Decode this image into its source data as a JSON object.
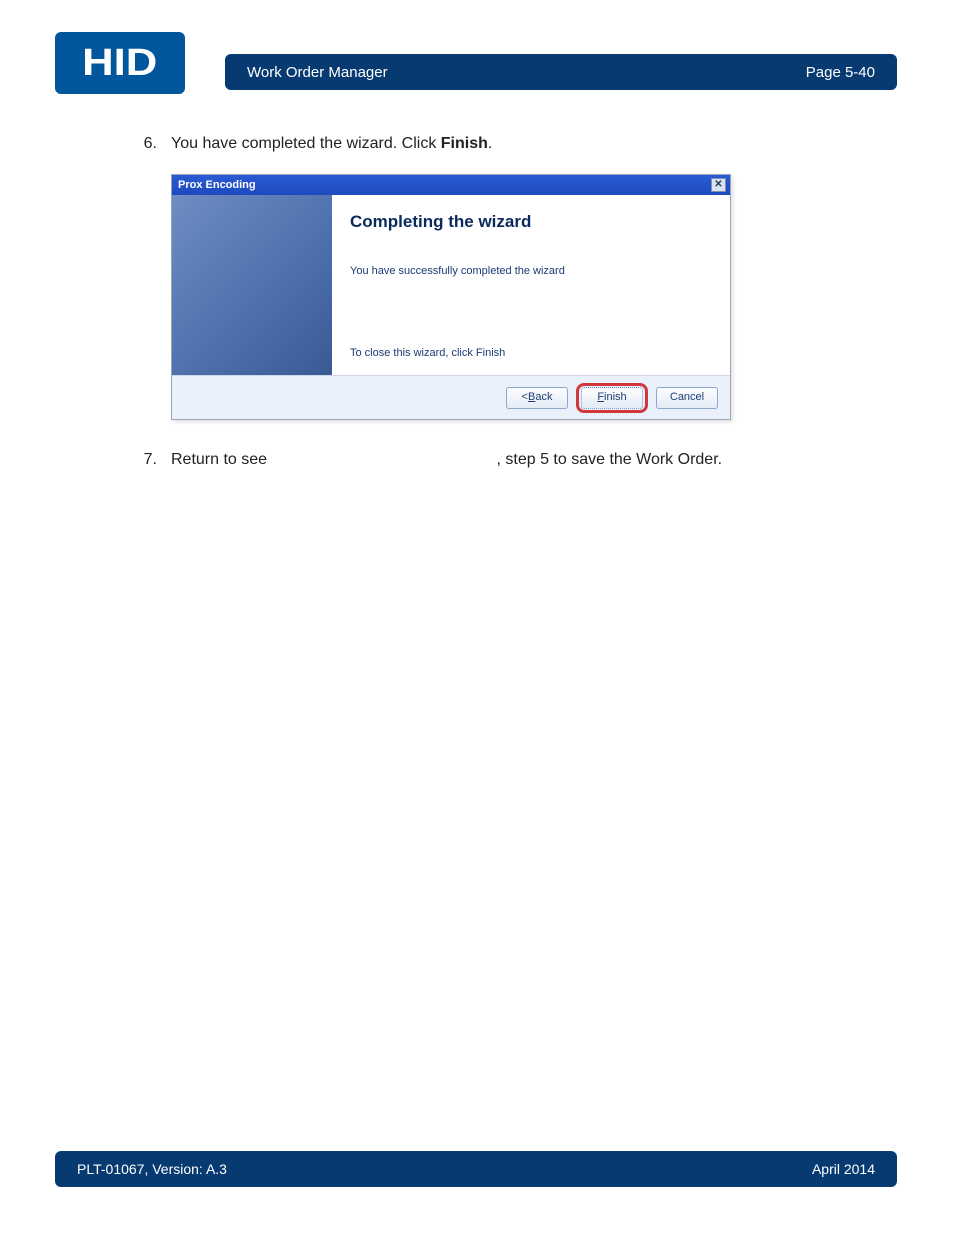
{
  "logo_text": "HID",
  "header": {
    "title": "Work Order Manager",
    "page": "Page 5-40"
  },
  "steps": {
    "s6_num": "6.",
    "s6_pre": "You have completed the wizard. Click ",
    "s6_bold": "Finish",
    "s6_post": ".",
    "s7_num": "7.",
    "s7_pre": "Return to see ",
    "s7_post": ", step 5 to save the Work Order."
  },
  "wizard": {
    "title": "Prox Encoding",
    "heading": "Completing the wizard",
    "message": "You have successfully completed the wizard",
    "close_hint": "To close this wizard, click Finish",
    "back_prefix": "< ",
    "back_u": "B",
    "back_rest": "ack",
    "finish_u": "F",
    "finish_rest": "inish",
    "cancel": "Cancel",
    "close_x": "✕"
  },
  "footer": {
    "left": "PLT-01067, Version: A.3",
    "right": "April 2014"
  }
}
